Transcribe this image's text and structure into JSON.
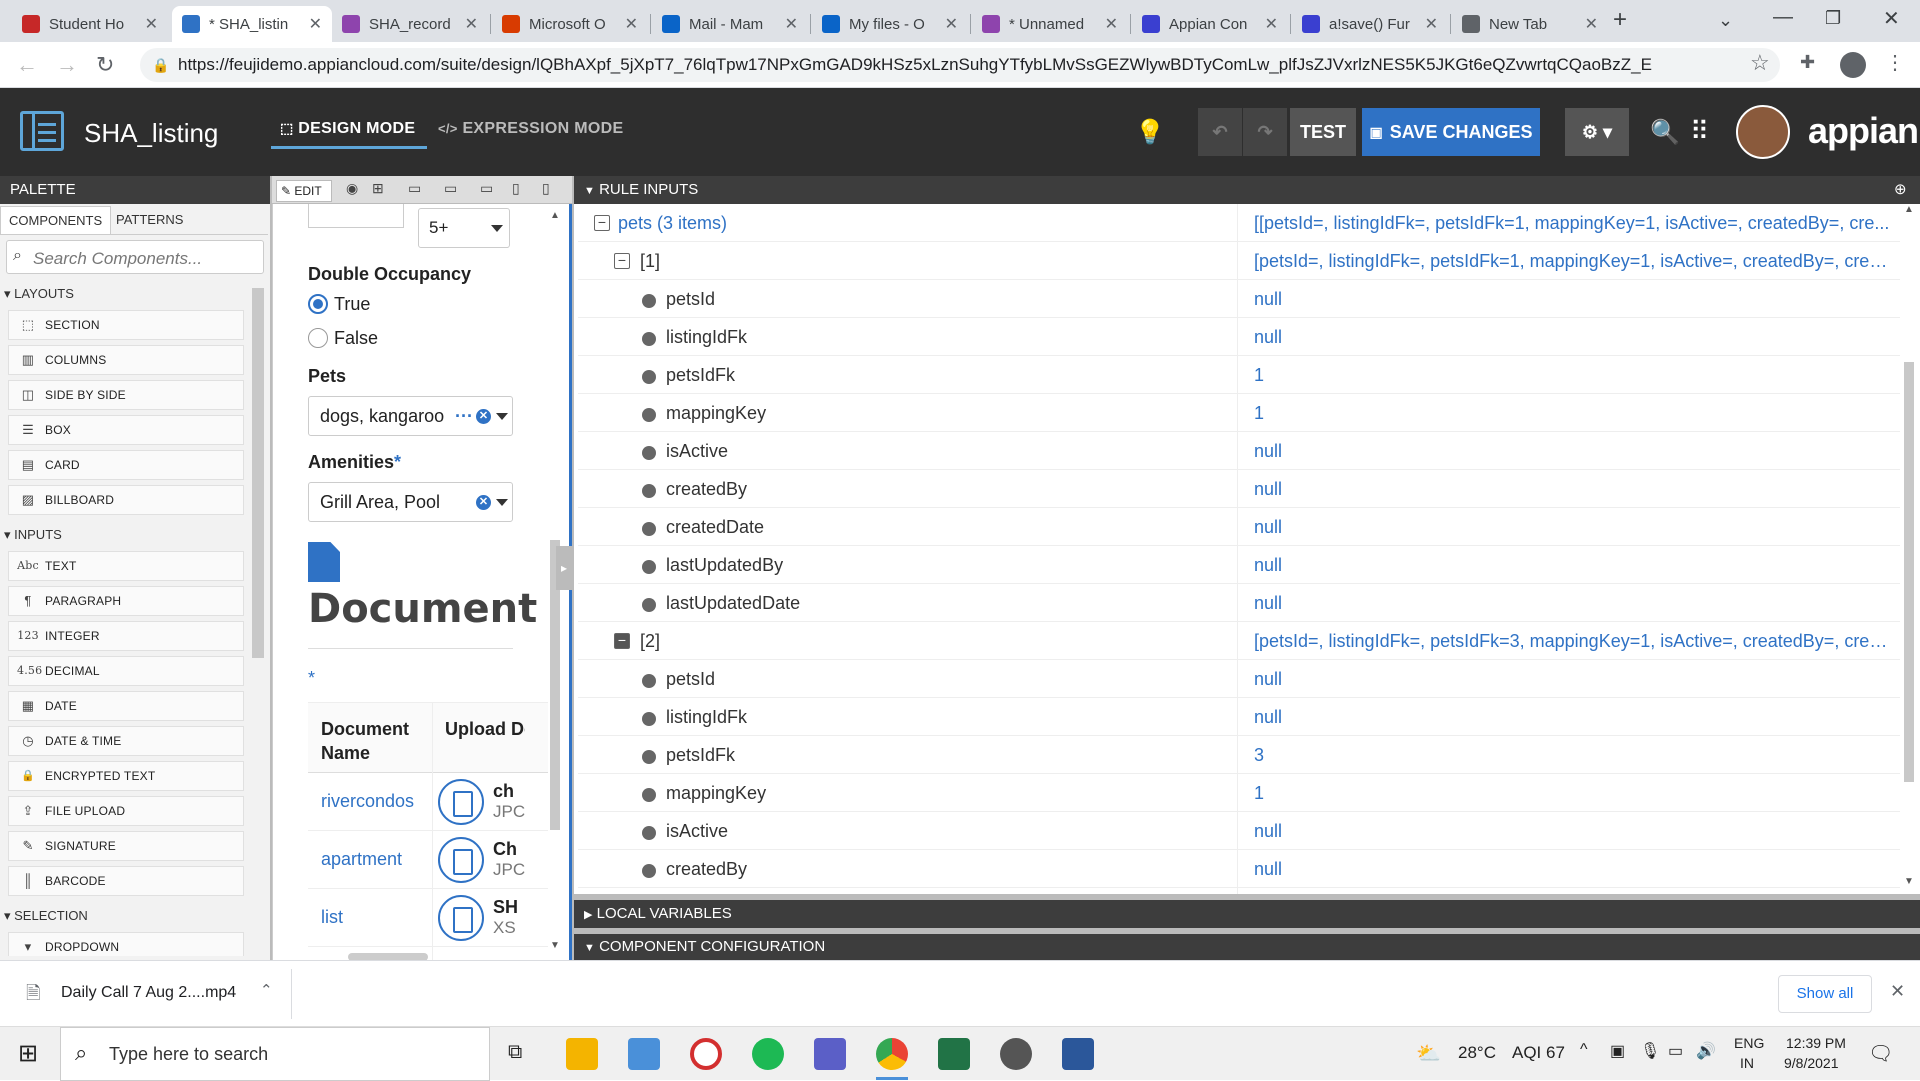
{
  "browser": {
    "tabs": [
      {
        "title": "Student Ho",
        "favicon_color": "#c62828",
        "favicon": "student-hub-icon"
      },
      {
        "title": "* SHA_listin",
        "favicon_color": "#2f72c5",
        "favicon": "appian-interface-icon",
        "active": true
      },
      {
        "title": "SHA_record",
        "favicon_color": "#8e44ad",
        "favicon": "appian-record-icon"
      },
      {
        "title": "Microsoft O",
        "favicon_color": "#d83b01",
        "favicon": "office-icon"
      },
      {
        "title": "Mail - Mam",
        "favicon_color": "#0a64c8",
        "favicon": "outlook-icon"
      },
      {
        "title": "My files - O",
        "favicon_color": "#0a64c8",
        "favicon": "onedrive-icon"
      },
      {
        "title": "* Unnamed",
        "favicon_color": "#8e44ad",
        "favicon": "appian-record-icon"
      },
      {
        "title": "Appian Con",
        "favicon_color": "#3a3fd0",
        "favicon": "appian-a-icon"
      },
      {
        "title": "a!save() Fur",
        "favicon_color": "#3a3fd0",
        "favicon": "appian-a-icon"
      },
      {
        "title": "New Tab",
        "favicon_color": "#5f6368",
        "favicon": "globe-icon"
      }
    ],
    "url": "https://feujidemo.appiancloud.com/suite/design/lQBhAXpf_5jXpT7_76lqTpw17NPxGmGAD9kHSz5xLznSuhgYTfybLMvSsGEZWlywBDTyComLw_plfJsZJVxrlzNES5K5JKGt6eQZvwrtqCQaoBzZ_E"
  },
  "header": {
    "title": "SHA_listing",
    "design_mode": "DESIGN MODE",
    "expression_mode": "EXPRESSION MODE",
    "test": "TEST",
    "save": "SAVE CHANGES",
    "brand": "appian"
  },
  "palette": {
    "title": "PALETTE",
    "tabs": [
      "COMPONENTS",
      "PATTERNS"
    ],
    "search_placeholder": "Search Components...",
    "sections": {
      "layouts": "LAYOUTS",
      "inputs": "INPUTS",
      "selection": "SELECTION"
    },
    "layouts": [
      {
        "label": "SECTION",
        "icon": "section-icon"
      },
      {
        "label": "COLUMNS",
        "icon": "columns-icon"
      },
      {
        "label": "SIDE BY SIDE",
        "icon": "side-by-side-icon"
      },
      {
        "label": "BOX",
        "icon": "box-icon"
      },
      {
        "label": "CARD",
        "icon": "card-icon"
      },
      {
        "label": "BILLBOARD",
        "icon": "billboard-icon"
      }
    ],
    "inputs": [
      {
        "label": "TEXT",
        "icon": "text-icon",
        "glyph": "Abc"
      },
      {
        "label": "PARAGRAPH",
        "icon": "paragraph-icon",
        "glyph": "¶"
      },
      {
        "label": "INTEGER",
        "icon": "integer-icon",
        "glyph": "123"
      },
      {
        "label": "DECIMAL",
        "icon": "decimal-icon",
        "glyph": "4.56"
      },
      {
        "label": "DATE",
        "icon": "calendar-icon",
        "glyph": "▦"
      },
      {
        "label": "DATE & TIME",
        "icon": "date-time-icon",
        "glyph": "◷"
      },
      {
        "label": "ENCRYPTED TEXT",
        "icon": "lock-icon",
        "glyph": "🔒"
      },
      {
        "label": "FILE UPLOAD",
        "icon": "upload-icon",
        "glyph": "⇪"
      },
      {
        "label": "SIGNATURE",
        "icon": "signature-icon",
        "glyph": "✎"
      },
      {
        "label": "BARCODE",
        "icon": "barcode-icon",
        "glyph": "║"
      }
    ],
    "selection": [
      {
        "label": "DROPDOWN",
        "icon": "dropdown-icon",
        "glyph": "▾"
      }
    ]
  },
  "canvas": {
    "toolbar": {
      "edit": "EDIT"
    },
    "top_select": "5+",
    "double_occupancy": {
      "label": "Double Occupancy",
      "options": [
        "True",
        "False"
      ],
      "selected": "True"
    },
    "pets": {
      "label": "Pets",
      "value": "dogs, kangaroo"
    },
    "amenities": {
      "label": "Amenities",
      "required": "*",
      "value": "Grill Area, Pool"
    },
    "document": {
      "heading": "Document",
      "required": "*",
      "col1": "Document Name",
      "col2": "Upload Docume",
      "rows": [
        {
          "name": "rivercondos",
          "file": "ch",
          "type": "JPC"
        },
        {
          "name": "apartment",
          "file": "Ch",
          "type": "JPC"
        },
        {
          "name": "list",
          "file": "SH",
          "type": "XS"
        }
      ]
    }
  },
  "rule_inputs": {
    "title": "RULE INPUTS",
    "rows": [
      {
        "key": "pets (3 items)",
        "value": "[[petsId=, listingIdFk=, petsIdFk=1, mappingKey=1, isActive=, createdBy=, cre...",
        "level": 0,
        "kind": "group"
      },
      {
        "key": "[1]",
        "value": "[petsId=, listingIdFk=, petsIdFk=1, mappingKey=1, isActive=, createdBy=, crea...",
        "level": 1,
        "kind": "group"
      },
      {
        "key": "petsId",
        "value": "null",
        "level": 2,
        "kind": "leaf"
      },
      {
        "key": "listingIdFk",
        "value": "null",
        "level": 2,
        "kind": "leaf"
      },
      {
        "key": "petsIdFk",
        "value": "1",
        "level": 2,
        "kind": "leaf"
      },
      {
        "key": "mappingKey",
        "value": "1",
        "level": 2,
        "kind": "leaf"
      },
      {
        "key": "isActive",
        "value": "null",
        "level": 2,
        "kind": "leaf"
      },
      {
        "key": "createdBy",
        "value": "null",
        "level": 2,
        "kind": "leaf"
      },
      {
        "key": "createdDate",
        "value": "null",
        "level": 2,
        "kind": "leaf"
      },
      {
        "key": "lastUpdatedBy",
        "value": "null",
        "level": 2,
        "kind": "leaf"
      },
      {
        "key": "lastUpdatedDate",
        "value": "null",
        "level": 2,
        "kind": "leaf"
      },
      {
        "key": "[2]",
        "value": "[petsId=, listingIdFk=, petsIdFk=3, mappingKey=1, isActive=, createdBy=, crea...",
        "level": 1,
        "kind": "group-dark"
      },
      {
        "key": "petsId",
        "value": "null",
        "level": 2,
        "kind": "leaf"
      },
      {
        "key": "listingIdFk",
        "value": "null",
        "level": 2,
        "kind": "leaf"
      },
      {
        "key": "petsIdFk",
        "value": "3",
        "level": 2,
        "kind": "leaf"
      },
      {
        "key": "mappingKey",
        "value": "1",
        "level": 2,
        "kind": "leaf"
      },
      {
        "key": "isActive",
        "value": "null",
        "level": 2,
        "kind": "leaf"
      },
      {
        "key": "createdBy",
        "value": "null",
        "level": 2,
        "kind": "leaf"
      }
    ],
    "local_variables": "LOCAL VARIABLES",
    "component_configuration": "COMPONENT CONFIGURATION"
  },
  "download": {
    "file": "Daily Call 7 Aug 2....mp4",
    "show_all": "Show all"
  },
  "taskbar": {
    "search_placeholder": "Type here to search",
    "weather": "28°C",
    "aqi": "AQI 67",
    "lang": "ENG",
    "region": "IN",
    "time": "12:39 PM",
    "date": "9/8/2021"
  },
  "colors": {
    "accent": "#2f72c5",
    "header_bg": "#2e2e2e",
    "save_bg": "#2f72c5"
  }
}
